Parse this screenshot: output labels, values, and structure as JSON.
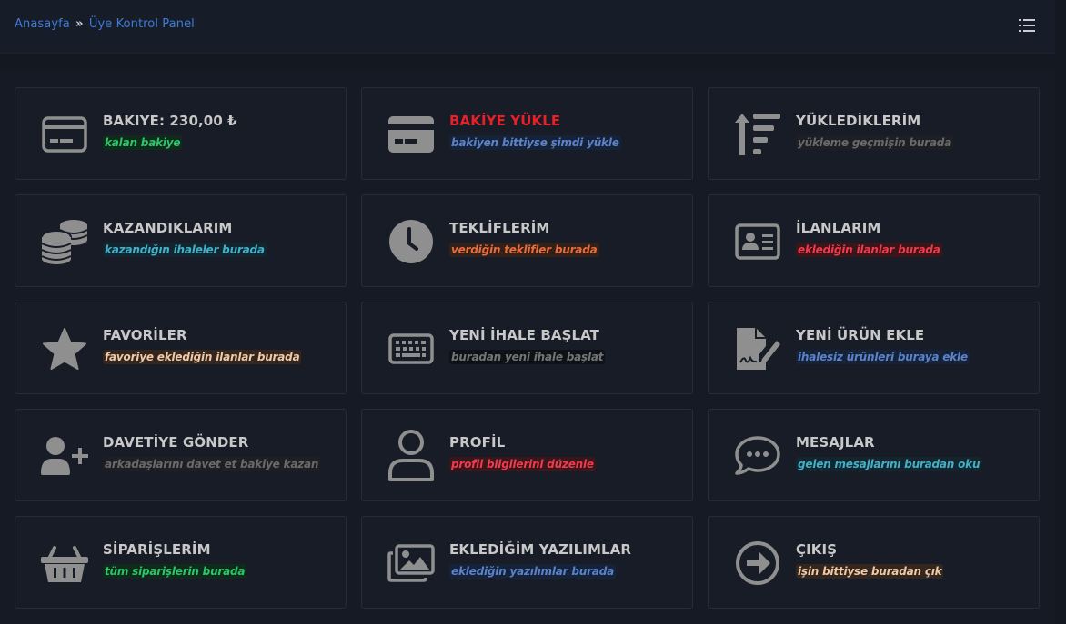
{
  "breadcrumb": {
    "home": "Anasayfa",
    "separator": "»",
    "current": "Üye Kontrol Panel"
  },
  "header": {
    "menu_icon": "list-icon"
  },
  "colors": {
    "background": "#131821",
    "card": "#171c26",
    "link": "#3d7bd8",
    "icon": "#8f8f8f"
  },
  "cards": [
    {
      "title": "BAKIYE: 230,00 ₺",
      "subtitle": "kalan bakiye",
      "icon": "credit-card-icon"
    },
    {
      "title": "BAKİYE YÜKLE",
      "subtitle": "bakiyen bittiyse şimdi yükle",
      "icon": "credit-card-solid-icon"
    },
    {
      "title": "YÜKLEDİKLERİM",
      "subtitle": "yükleme geçmişin burada",
      "icon": "sort-amount-up-icon"
    },
    {
      "title": "KAZANDIKLARIM",
      "subtitle": "kazandığın ihaleler burada",
      "icon": "coins-icon"
    },
    {
      "title": "TEKLİFLERİM",
      "subtitle": "verdiğin teklifler burada",
      "icon": "clock-icon"
    },
    {
      "title": "İLANLARIM",
      "subtitle": "eklediğin ilanlar burada",
      "icon": "id-card-icon"
    },
    {
      "title": "FAVORİLER",
      "subtitle": "favoriye eklediğin ilanlar burada",
      "icon": "star-icon"
    },
    {
      "title": "YENİ İHALE BAŞLAT",
      "subtitle": "buradan yeni ihale başlat",
      "icon": "keyboard-icon"
    },
    {
      "title": "YENİ ÜRÜN EKLE",
      "subtitle": "ihalesiz ürünleri buraya ekle",
      "icon": "file-signature-icon"
    },
    {
      "title": "DAVETİYE GÖNDER",
      "subtitle": "arkadaşlarını davet et bakiye kazan",
      "icon": "user-plus-icon"
    },
    {
      "title": "PROFİL",
      "subtitle": "profil bilgilerini düzenle",
      "icon": "user-icon"
    },
    {
      "title": "MESAJLAR",
      "subtitle": "gelen mesajlarını buradan oku",
      "icon": "comment-dots-icon"
    },
    {
      "title": "SİPARİŞLERİM",
      "subtitle": "tüm siparişlerin burada",
      "icon": "shopping-basket-icon"
    },
    {
      "title": "EKLEDİĞİM YAZILIMLAR",
      "subtitle": "eklediğin yazılımlar burada",
      "icon": "images-icon"
    },
    {
      "title": "ÇIKIŞ",
      "subtitle": "işin bittiyse buradan çık",
      "icon": "arrow-circle-right-icon"
    }
  ]
}
